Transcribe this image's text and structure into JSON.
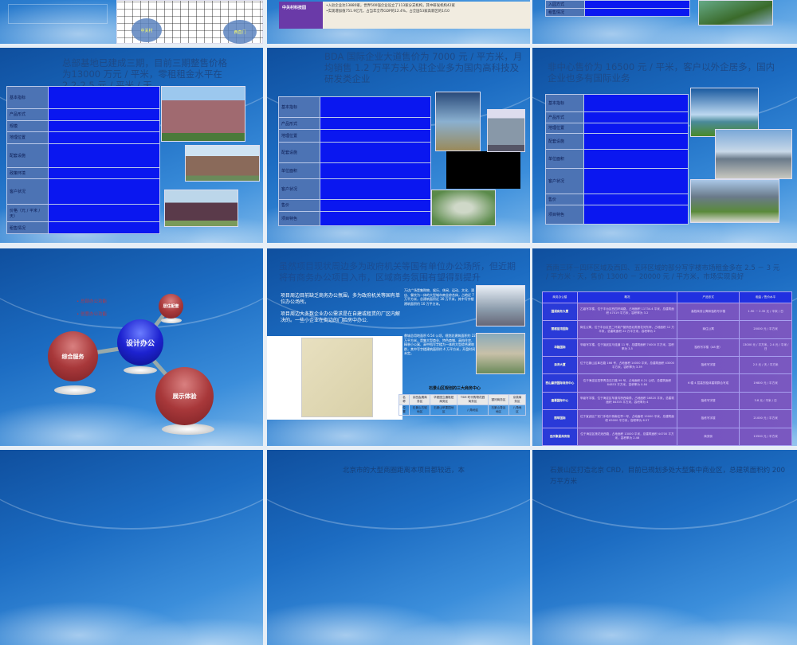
{
  "slides": {
    "s0": {
      "map_labels": [
        "中关村",
        "西直门"
      ]
    },
    "s1": {
      "row_label": "中关村科技园",
      "lines": [
        "•入驻企业达13880家，世界500强企业设立了113家分支机构，其中研发机构42家",
        "•实现增加值751.9亿元，占当年全市GDP的12.4%，占全国53家高新区的1/10"
      ]
    },
    "s2": {
      "rows": [
        "入园方式",
        "租售情况"
      ]
    },
    "s3": {
      "title": "总部基地已建成三期，目前三期整售价格为13000 万元 / 平米，零租租金水平在 2.2-2.5 元 / 平米 / 天",
      "rows": [
        "基本指标",
        "产品形式",
        "规模",
        "地理位置",
        "配套设施",
        "政策环境",
        "客户状况",
        "价格（元 / 平米 / 天）",
        "租售情况"
      ]
    },
    "s4": {
      "title": "BDA 国际企业大道售价为 7000 元 / 平方米，月均销售 1.2 万平方米入驻企业多为国内高科技及研发类企业",
      "rows": [
        "基本指标",
        "产品形式",
        "地理位置",
        "配套设施",
        "单位面积",
        "客户状况",
        "售价",
        "项目特色"
      ]
    },
    "s5": {
      "title": "非中心售价为 16500 元 / 平米，客户以外企居多，国内企业也多有国际业务",
      "rows": [
        "基本指标",
        "产品形式",
        "地理位置",
        "配套设施",
        "单位面积",
        "客户状况",
        "售价",
        "项目特色"
      ]
    },
    "s6": {
      "bullets": [
        "总部办公功能",
        "创意办公功能"
      ],
      "center": "设计办公",
      "nodes": [
        "综合服务",
        "居住配套",
        "展示体验"
      ]
    },
    "s7": {
      "title": "虽然项目现状周边多为政府机关等国有单位办公场所，但近期将有商务办公项目入市，区域商务氛围有望得到提升",
      "bullets": [
        "项目周边目前缺乏商务办公氛围，多为政府机关等国有单位办公场所。",
        "项目周边大多数企业办公需求是在自建或租赁的厂区内解决的。一些小企业在街边的门脸房中办公."
      ],
      "box1": "万达广场是集购物、娱乐、休闲、运动、文化、酒店、餐饮为一体的大型城市商业综合体，占地近 7 万平方米，总建筑面积近 30 万平米，其中写字楼建筑面积约 10 万平方米。",
      "box2": "鼎城总用地面积 6.54 公顷，规划总建筑面积约 22 万平方米，是集大型商业、特色商铺、高档住宅、精装小公寓、高中档写字楼为一体的大型综合建筑群，其中写字楼建筑面积约 4 万平方米，开盘时间未定。",
      "table_caption": "石景山区规划的三大商务中心",
      "table": [
        [
          "名称",
          "京西会展商务区",
          "华夏园立通枢纽商务区",
          "TSM 时代购物花园商务区",
          "银河商务区",
          "京英商务区"
        ],
        [
          "位置",
          "石景山古城地区",
          "石景山苹果园地区",
          "八角地区",
          "石景山鲁谷地区",
          "八角地区"
        ]
      ]
    },
    "s8": {
      "title": "西南三环－四环区域及西四、五环区域的部分写字楼市场租金多在 2.5 － 3 元 / 平方米 · 天，售价 13000 － 20000 元 / 平方米，市场实现良好",
      "headers": [
        "商务办公楼",
        "概况",
        "产品形式",
        "租金 / 售价水平"
      ],
      "rows": [
        [
          "国润商务大厦",
          "乙级写字楼，位于丰台区西四环南路，占地面积 11734.4 平米，总建筑面积 47019 平方米，容积率为 3.2",
          "高档商务公寓和独栋写字楼",
          "1.90 － 2.35 元 / 平米 / 日"
        ],
        [
          "丽都蓝湾国际",
          "商住公寓，位于丰台区西二环菜户营桥西北角莲花河东岸，占地面积 12 万平米，总建筑面积 22 万平方米，容积率为 2",
          "商住公寓",
          "20000 元 / 平方米"
        ],
        [
          "华融国际",
          "甲级写字楼，位于宣武区马连道 11 号，总建筑面积 74000 平方米，容积率为 3.5",
          "独栋写字楼（A8 座）",
          "13000 元 / 平方米，2.4 元 / 平米 / 日"
        ],
        [
          "泽洋大厦",
          "位于石景山区阜石路 166 号，占地面积 14000 平米，总建筑面积 43000 平方米，容积率为 3.39",
          "独栋写字楼",
          "2.5 元 / 天 / 平方米"
        ],
        [
          "西山赢府国际商务中心",
          "位于海淀区四季青杏石口路 99 号，占地面积 8.21 公顷，总建筑面积 84853 平方米，容积率为 0.84",
          "6 幢 4 层高的独体建筑群合写成",
          "19800 元 / 平方米"
        ],
        [
          "嘉豪国际中心",
          "甲级写字楼，位于海淀区车道沟桥西南角，占地面积 16820 平米，总建筑面积 84335 平方米，容积率为 4",
          "独栋写字楼",
          "3.8 元 / 平米 / 日"
        ],
        [
          "丽苹国际",
          "位于宣武区广安门手帕口桥南往早一号，占地面积 19000 平米，总建筑面积 65000 平方米，容积率为 6.57",
          "独栋写字楼",
          "21000 元 / 平方米"
        ],
        [
          "远乐聚星商务街",
          "位于海淀区莲花池西路，占地面积 13000 平米，总建筑面积 44700 平方米，容积率为 2.46",
          "商务街",
          "13500 元 / 平方米"
        ]
      ]
    },
    "s10": {
      "title": "北京市的大型商圈距离本项目都较远，本"
    },
    "s11": {
      "title": "石景山区打造北京 CRD，目前已规划多处大型集中商业区，总建筑面积约 200 万平方米"
    }
  }
}
